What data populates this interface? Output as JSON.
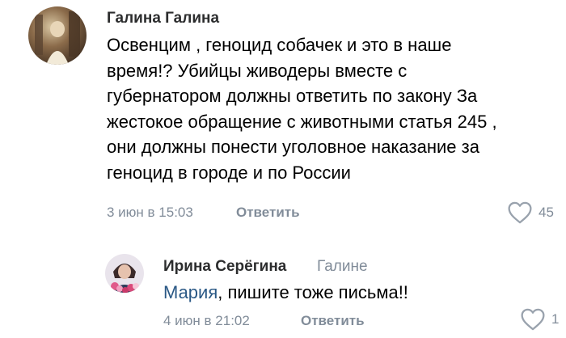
{
  "comments": [
    {
      "author": "Галина Галина",
      "text_lines": [
        "Освенцим , геноцид собачек и это в наше",
        "время!? Убийцы живодеры вместе с",
        "губернатором должны ответить по закону За",
        "жестокое обращение с животными статья 245 ,",
        "они должны понести уголовное наказание за",
        "геноцид в городе и по России"
      ],
      "time": "3 июн в 15:03",
      "reply_label": "Ответить",
      "likes": "45",
      "avatar_icon": "user-photo-icon",
      "like_icon": "heart-outline-icon"
    }
  ],
  "reply": {
    "author": "Ирина Серёгина",
    "reply_to": "Галине",
    "mention": "Мария",
    "text": ", пишите тоже письма!!",
    "time": "4 июн в 21:02",
    "reply_label": "Ответить",
    "likes": "1",
    "avatar_icon": "user-photo-icon",
    "like_icon": "heart-outline-icon"
  },
  "colors": {
    "author": "#2c2d2e",
    "secondary": "#818c99",
    "link": "#2a5885",
    "text": "#000000"
  }
}
